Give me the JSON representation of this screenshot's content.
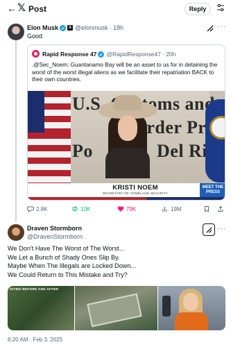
{
  "header": {
    "back_glyph": "←",
    "logo_glyph": "𝕏",
    "title": "Post",
    "reply_label": "Reply"
  },
  "tweet1": {
    "name": "Elon Musk",
    "handle": "@elonmusk",
    "time": "· 18h",
    "text": "Good",
    "quote": {
      "name": "Rapid Response 47",
      "handle": "@RapidResponse47",
      "time": "· 20h",
      "text": ".@Sec_Noem: Guantanamo Bay will be an asset to us for in detaining the worst of the worst illegal aliens as we facilitate their repatriation BACK to their own countries.",
      "video": {
        "lower_third_name": "KRISTI NOEM",
        "lower_third_title": "SECRETARY OF HOMELAND SECURITY",
        "wall_line1": "U.S. Customs and",
        "wall_line2": "Border Protectio",
        "wall_line3": "Del Ri",
        "wall_line4": "Po",
        "badge": "MEET THE PRESS"
      }
    },
    "actions": {
      "replies": "2.8K",
      "reposts": "10K",
      "likes": "79K",
      "views": "19M"
    }
  },
  "tweet2": {
    "name": "Draven Stormborn",
    "handle": "@DravenStormborn",
    "lines": [
      "We Don't Have The Worst of The Worst...",
      "We Let a Bunch of Shady Ones Slip By.",
      "Maybe When The Illegals are Locked Down...",
      "We Could Return to This Mistake and Try?"
    ],
    "media_label": "GITMO BEFORE AND AFTER",
    "timestamp": "6:20 AM · Feb 3, 2025"
  },
  "colors": {
    "verified": "#1d9bf0",
    "repost": "#00ba7c",
    "like": "#f91880",
    "muted": "#536471"
  }
}
